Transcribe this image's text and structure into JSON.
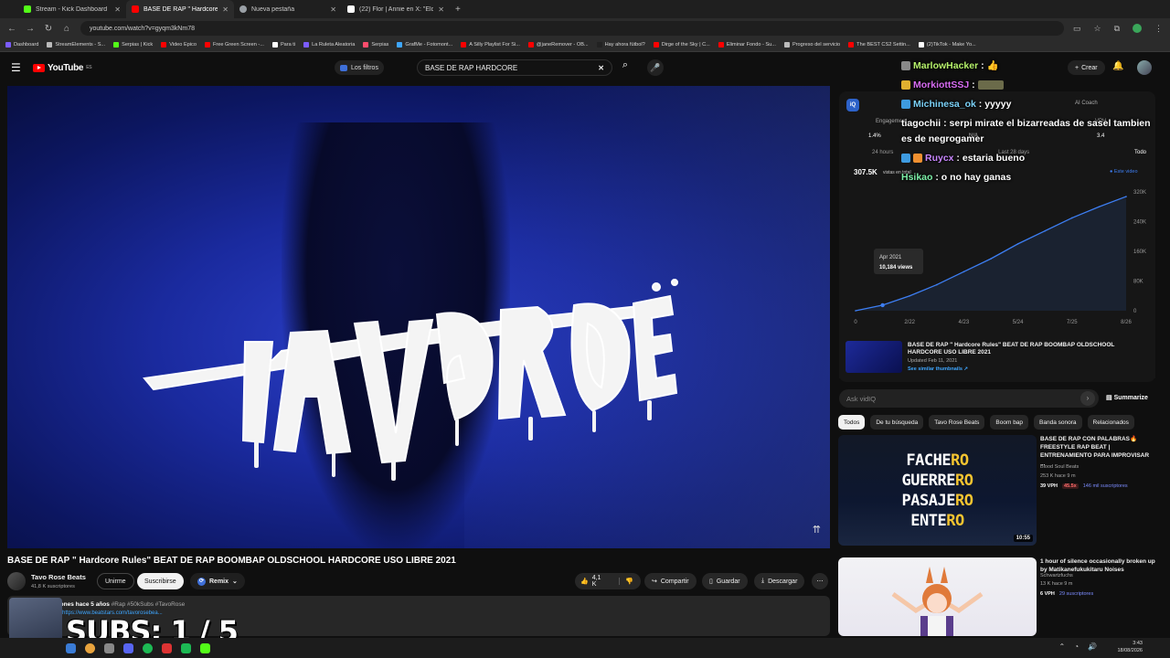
{
  "browser": {
    "tabs": [
      {
        "title": "Stream - Kick Dashboard",
        "color": "#53fc18",
        "active": false
      },
      {
        "title": "BASE DE RAP \" Hardcore Rules\"",
        "color": "#ff0000",
        "active": true
      },
      {
        "title": "Nueva pestaña",
        "color": "#9aa0a6",
        "active": false
      },
      {
        "title": "(22) Flor | Annie en X: \"Elded h",
        "color": "#ffffff",
        "active": false
      }
    ],
    "url": "youtube.com/watch?v=gyqm3kNm78",
    "bookmarks": [
      {
        "label": "Dashboard",
        "color": "#7b5cff"
      },
      {
        "label": "StreamElements - S...",
        "color": "#bbbbbb"
      },
      {
        "label": "Serpias | Kick",
        "color": "#53fc18"
      },
      {
        "label": "Video Epico",
        "color": "#ff0000"
      },
      {
        "label": "Free Green Screen -...",
        "color": "#ff0000"
      },
      {
        "label": "Para ti",
        "color": "#ffffff"
      },
      {
        "label": "La Ruleta Aleatoria",
        "color": "#7b5cff"
      },
      {
        "label": "Serpias",
        "color": "#ff4d6d"
      },
      {
        "label": "GrafMe - Fotomont...",
        "color": "#3ea6ff"
      },
      {
        "label": "A Silly Playlist For Si...",
        "color": "#ff0000"
      },
      {
        "label": "@janeRemover - OB...",
        "color": "#ff0000"
      },
      {
        "label": "Hay ahora fútbol?",
        "color": "#222222"
      },
      {
        "label": "Dirge of the Sky | C...",
        "color": "#ff0000"
      },
      {
        "label": "Eliminar Fondo - Su...",
        "color": "#ff0000"
      },
      {
        "label": "Progreso del servicio",
        "color": "#bbbbbb"
      },
      {
        "label": "The BEST CS2 Settin...",
        "color": "#ff0000"
      },
      {
        "label": "(2)TikTok - Make Yo...",
        "color": "#ffffff"
      }
    ]
  },
  "youtube": {
    "logo": "YouTube",
    "logo_sup": "ES",
    "filters_label": "Los filtros",
    "search_value": "BASE DE RAP HARDCORE",
    "create_label": "Crear"
  },
  "video": {
    "title": "BASE DE RAP \" Hardcore Rules\" BEAT DE RAP BOOMBAP OLDSCHOOL HARDCORE USO LIBRE 2021",
    "graffiti_text": "TAVO ROSE",
    "channel": "Tavo Rose Beats",
    "subs": "41,8 K suscriptores",
    "join_label": "Unirme",
    "subscribe_label": "Suscribirse",
    "remix_label": "Remix",
    "likes": "4,1 K",
    "share_label": "Compartir",
    "save_label": "Guardar",
    "download_label": "Descargar",
    "desc_meta": "307 K visualizaciones  hace 5 años",
    "desc_tags": "#Rap #50kSubs #TavoRose",
    "desc_link": "https://www.beatstars.com/tavorosebea..."
  },
  "chat": [
    {
      "user": "MarlowHacker",
      "msg": "👍",
      "color": "#b6f26b"
    },
    {
      "user": "MorkiottSSJ",
      "msg": "",
      "color": "#d76bf2"
    },
    {
      "user": "Michinesa_ok",
      "msg": "yyyyy",
      "color": "#7bd1f7"
    },
    {
      "user": "tiagochii",
      "msg": "serpi mirate el bizarreadas de sasel tambien es de negrogamer",
      "color": "#ffffff"
    },
    {
      "user": "Ruycx",
      "msg": "estaria bueno",
      "color": "#c987ff"
    },
    {
      "user": "Hsikao",
      "msg": "o no hay ganas",
      "color": "#7df0a8"
    }
  ],
  "vidiq": {
    "logo": "iQ",
    "coach": "AI Coach",
    "stats": {
      "engagement_label": "Engagement",
      "engagement": "1.4%",
      "na": "N/A",
      "vph_label": "VPH",
      "vph": "3.4"
    },
    "tabs": [
      "24 hours",
      "",
      "",
      "",
      "Last 28 days",
      "",
      "Todo"
    ],
    "views_total": "307.5K",
    "views_selector": "vistas en total",
    "legend": "● Este video",
    "chart_data": {
      "type": "area",
      "title": "",
      "series": [
        {
          "name": "Este video",
          "values": [
            0,
            15,
            40,
            70,
            105,
            140,
            180,
            215,
            250,
            280,
            307.5
          ]
        }
      ],
      "x": [
        "0",
        "",
        "2/22",
        "",
        "4/23",
        "",
        "5/24",
        "",
        "7/25",
        "",
        "8/26"
      ],
      "xticks": [
        "0",
        "2/22",
        "4/23",
        "5/24",
        "7/25",
        "8/26"
      ],
      "yticks": [
        "0",
        "80K",
        "160K",
        "240K",
        "320K"
      ],
      "ylim": [
        0,
        320
      ],
      "tooltip": {
        "label": "Apr 2021",
        "value": "10,184 views"
      }
    }
  },
  "related_card": {
    "title": "BASE DE RAP \" Hardcore Rules\" BEAT DE RAP BOOMBAP OLDSCHOOL HARDCORE USO LIBRE 2021",
    "updated": "Updated Feb 11, 2021",
    "see_similar": "See similar thumbnails ↗"
  },
  "ask": {
    "placeholder": "Ask vidIQ",
    "summarize": "Summarize"
  },
  "chips": [
    "Todos",
    "De tu búsqueda",
    "Tavo Rose Beats",
    "Boom bap",
    "Banda sonora",
    "Relacionados"
  ],
  "recs": [
    {
      "title": "BASE DE RAP CON PALABRAS🔥 FREESTYLE RAP BEAT | ENTRENAMIENTO PARA IMPROVISAR ...",
      "channel": "Blood Soul Beats",
      "meta": "253 K  hace 9 m",
      "vph": "39 VPH",
      "pct": "45.5x",
      "msubs": "146 mil suscriptores",
      "duration": "10:55",
      "thumb_words": [
        {
          "a": "FACHE",
          "b": "RO"
        },
        {
          "a": "GUERRE",
          "b": "RO"
        },
        {
          "a": "PASAJE",
          "b": "RO"
        },
        {
          "a": "ENTE",
          "b": "RO"
        }
      ]
    },
    {
      "title": "1 hour of silence occasionally broken up by Matikanefukukitaru Noises",
      "channel": "Schwartzfuchs",
      "meta": "13 K  hace 9 m",
      "vph": "6 VPH",
      "msubs": "29 suscriptores"
    }
  ],
  "overlay": {
    "subs": "SUBS: 1 / 5"
  },
  "taskbar": {
    "time": "3:43",
    "date": "18/08/2026"
  }
}
